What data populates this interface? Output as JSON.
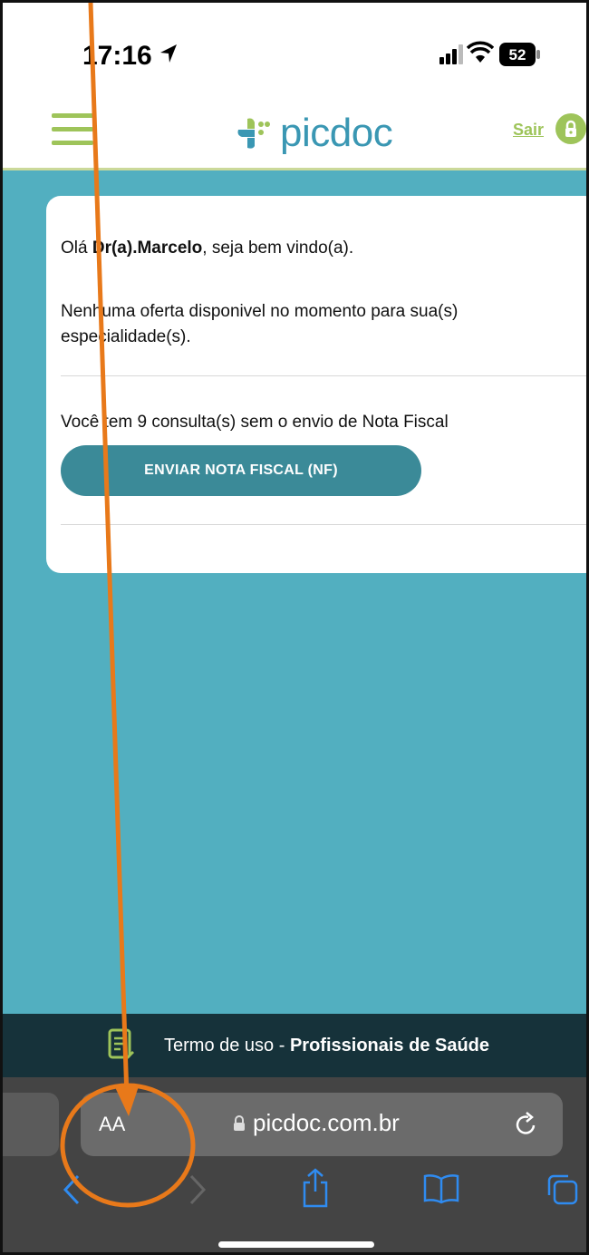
{
  "status_bar": {
    "time": "17:16",
    "battery": "52"
  },
  "header": {
    "logo_text": "picdoc",
    "logout_label": "Sair"
  },
  "card": {
    "greeting_prefix": "Olá ",
    "doctor_name": "Dr(a).Marcelo",
    "greeting_suffix": ", seja bem vindo(a).",
    "no_offers": "Nenhuma oferta disponivel no momento para sua(s) especialidade(s).",
    "pending_invoices": "Você tem 9 consulta(s) sem o envio de Nota Fiscal",
    "send_invoice_button": "ENVIAR NOTA FISCAL (NF)"
  },
  "footer": {
    "terms_prefix": "Termo de uso - ",
    "terms_bold": "Profissionais de Saúde"
  },
  "browser": {
    "text_size_label": "AA",
    "url": "picdoc.com.br"
  },
  "colors": {
    "brand_green": "#9ec45a",
    "brand_blue": "#3a97b3",
    "main_bg": "#52afc0",
    "button": "#3b8a98",
    "footer_bg": "#16323a",
    "annotation": "#e8791a"
  }
}
